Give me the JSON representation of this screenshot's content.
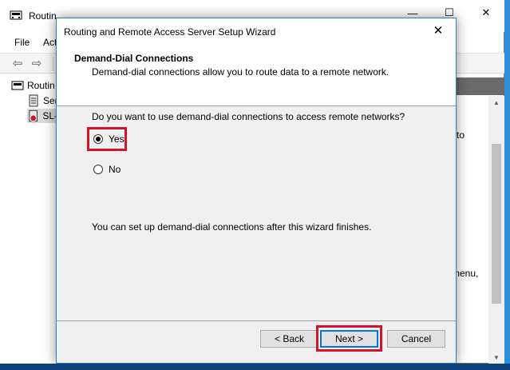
{
  "background_window": {
    "title": "Routin",
    "controls": {
      "minimize": "—",
      "maximize": "☐",
      "close": "✕"
    },
    "menu": [
      "File",
      "Act"
    ],
    "tree": [
      {
        "label": "Routin",
        "icon": "server-icon"
      },
      {
        "label": "Ser",
        "icon": "server-status-icon"
      },
      {
        "label": "SL-",
        "icon": "server-error-icon"
      }
    ],
    "right_pane_fragments": [
      "to",
      "menu,"
    ]
  },
  "wizard": {
    "title": "Routing and Remote Access Server Setup Wizard",
    "close_glyph": "✕",
    "heading": "Demand-Dial Connections",
    "subheading": "Demand-dial connections allow you to route data to a remote network.",
    "question": "Do you want to use demand-dial connections to access remote networks?",
    "options": [
      {
        "label": "Yes",
        "selected": true
      },
      {
        "label": "No",
        "selected": false
      }
    ],
    "footnote": "You can set up demand-dial connections after this wizard finishes.",
    "buttons": {
      "back": "< Back",
      "next": "Next >",
      "cancel": "Cancel"
    }
  },
  "colors": {
    "highlight": "#d2142a",
    "accent": "#0078d7"
  }
}
